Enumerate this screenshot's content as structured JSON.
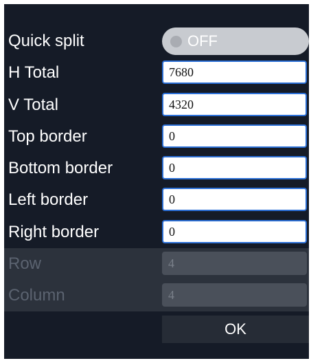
{
  "quick_split": {
    "label": "Quick split",
    "toggle_state": "OFF"
  },
  "fields": [
    {
      "label": "H Total",
      "value": "7680",
      "enabled": true
    },
    {
      "label": "V Total",
      "value": "4320",
      "enabled": true
    },
    {
      "label": "Top border",
      "value": "0",
      "enabled": true
    },
    {
      "label": "Bottom border",
      "value": "0",
      "enabled": true
    },
    {
      "label": "Left border",
      "value": "0",
      "enabled": true
    },
    {
      "label": "Right border",
      "value": "0",
      "enabled": true
    },
    {
      "label": "Row",
      "value": "4",
      "enabled": false
    },
    {
      "label": "Column",
      "value": "4",
      "enabled": false
    }
  ],
  "ok_button": {
    "label": "OK"
  },
  "colors": {
    "panel_background": "#151b27",
    "field_border": "#2b6fd6",
    "toggle_off": "#c8cbd0",
    "disabled_row": "#2c323c"
  }
}
